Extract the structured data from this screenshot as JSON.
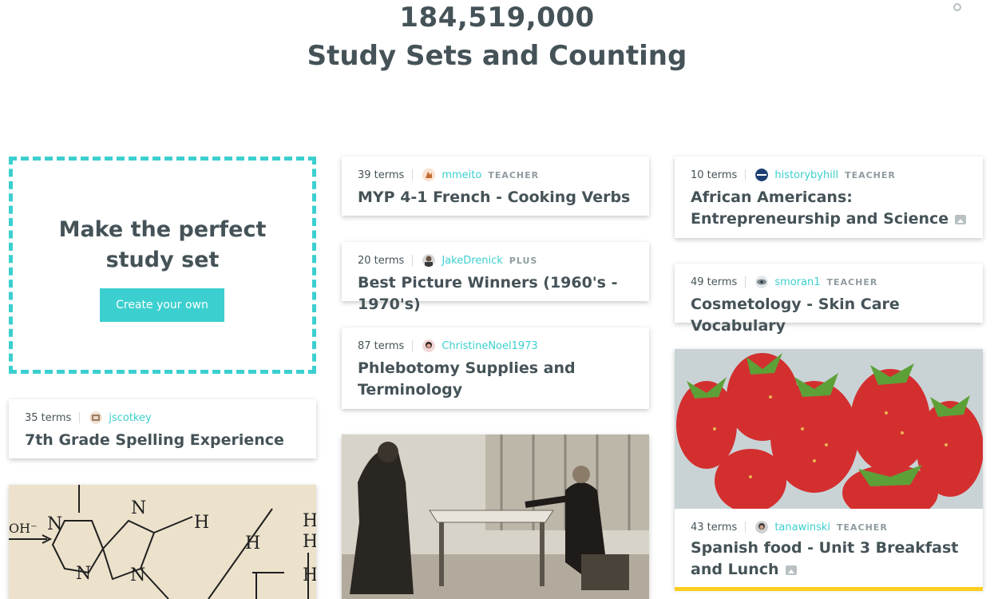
{
  "hero": {
    "count": "184,519,000",
    "subtitle": "Study Sets and Counting"
  },
  "promo": {
    "title_line1": "Make the perfect",
    "title_line2": "study set",
    "button_label": "Create your own"
  },
  "cards": [
    {
      "terms": "39 terms",
      "user": "mmeito",
      "badge": "TEACHER",
      "title": "MYP 4-1 French - Cooking Verbs"
    },
    {
      "terms": "10 terms",
      "user": "historybyhill",
      "badge": "TEACHER",
      "title": "African Americans: Entrepreneurship and Science",
      "has_image_icon": true
    },
    {
      "terms": "20 terms",
      "user": "JakeDrenick",
      "badge": "PLUS",
      "title": "Best Picture Winners (1960's - 1970's)"
    },
    {
      "terms": "49 terms",
      "user": "smoran1",
      "badge": "TEACHER",
      "title": "Cosmetology - Skin Care Vocabulary"
    },
    {
      "terms": "87 terms",
      "user": "ChristineNoel1973",
      "badge": "",
      "title": "Phlebotomy Supplies and Terminology"
    },
    {
      "terms": "35 terms",
      "user": "jscotkey",
      "badge": "",
      "title": "7th Grade Spelling Experience"
    },
    {
      "terms": "43 terms",
      "user": "tanawinski",
      "badge": "TEACHER",
      "title": "Spanish food - Unit 3 Breakfast and Lunch",
      "has_image_icon": true
    }
  ],
  "images": {
    "chem_labels": [
      "N",
      "H",
      "OH⁻",
      "N",
      "H",
      "H",
      "N",
      "N",
      "H",
      "H"
    ],
    "strawberry_image": "strawberries-photo",
    "vintage_image": "vintage-photo"
  },
  "colors": {
    "accent": "#3ccfcf",
    "text": "#455358",
    "badge": "#8f9ba0",
    "highlight_bar": "#ffcd1f"
  }
}
